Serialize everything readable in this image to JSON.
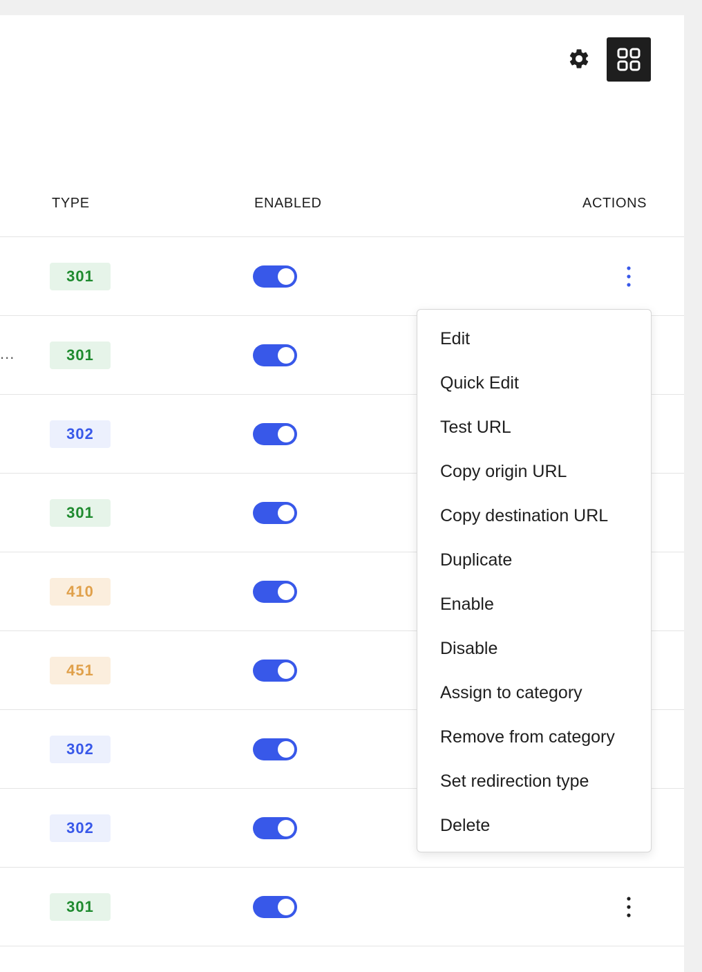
{
  "toolbar": {
    "settings_icon": "gear-icon",
    "view_icon": "grid-view-icon"
  },
  "table": {
    "columns": {
      "type": "TYPE",
      "enabled": "ENABLED",
      "actions": "ACTIONS"
    },
    "rows": [
      {
        "type": "301",
        "enabled": true,
        "truncated_text": ""
      },
      {
        "type": "301",
        "enabled": true,
        "truncated_text": "..."
      },
      {
        "type": "302",
        "enabled": true,
        "truncated_text": ""
      },
      {
        "type": "301",
        "enabled": true,
        "truncated_text": ""
      },
      {
        "type": "410",
        "enabled": true,
        "truncated_text": ""
      },
      {
        "type": "451",
        "enabled": true,
        "truncated_text": ""
      },
      {
        "type": "302",
        "enabled": true,
        "truncated_text": ""
      },
      {
        "type": "302",
        "enabled": true,
        "truncated_text": ""
      },
      {
        "type": "301",
        "enabled": true,
        "truncated_text": ""
      }
    ]
  },
  "badge_colors": {
    "301": {
      "bg": "#e6f4e9",
      "fg": "#1e8a2e"
    },
    "302": {
      "bg": "#ecf0fd",
      "fg": "#3858e9"
    },
    "410": {
      "bg": "#fbeedd",
      "fg": "#e0a04a"
    },
    "451": {
      "bg": "#fbeedd",
      "fg": "#e0a04a"
    }
  },
  "colors": {
    "accent": "#3858e9",
    "active_kebab": "#3858e9",
    "inactive_kebab": "#1e1e1e"
  },
  "actions_menu": {
    "items": [
      "Edit",
      "Quick Edit",
      "Test URL",
      "Copy origin URL",
      "Copy destination URL",
      "Duplicate",
      "Enable",
      "Disable",
      "Assign to category",
      "Remove from category",
      "Set redirection type",
      "Delete"
    ]
  }
}
